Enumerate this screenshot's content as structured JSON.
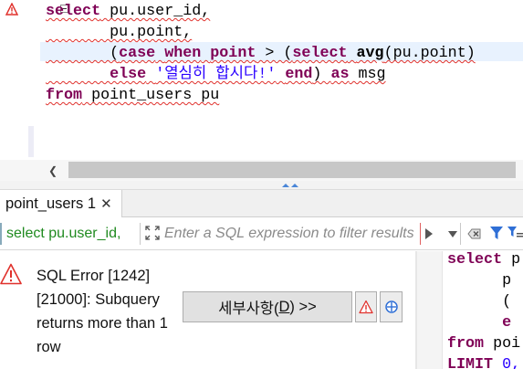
{
  "editor": {
    "lines": [
      [
        {
          "t": "select",
          "k": "kw"
        },
        {
          "t": " pu.user_id,",
          "k": "plain"
        }
      ],
      [
        {
          "t": "       pu.point,",
          "k": "plain"
        }
      ],
      [
        {
          "t": "       (",
          "k": "plain"
        },
        {
          "t": "case",
          "k": "kw"
        },
        {
          "t": " ",
          "k": "plain"
        },
        {
          "t": "when",
          "k": "kw"
        },
        {
          "t": " ",
          "k": "plain"
        },
        {
          "t": "point",
          "k": "kw"
        },
        {
          "t": " > (",
          "k": "plain"
        },
        {
          "t": "select",
          "k": "kw"
        },
        {
          "t": " ",
          "k": "plain"
        },
        {
          "t": "avg",
          "k": "fn"
        },
        {
          "t": "(pu.point)",
          "k": "plain"
        }
      ],
      [
        {
          "t": "       ",
          "k": "plain"
        },
        {
          "t": "else",
          "k": "kw"
        },
        {
          "t": " ",
          "k": "plain"
        },
        {
          "t": "'열심히 합시다!'",
          "k": "str"
        },
        {
          "t": " ",
          "k": "plain"
        },
        {
          "t": "end",
          "k": "kw"
        },
        {
          "t": ") ",
          "k": "plain"
        },
        {
          "t": "as",
          "k": "kw"
        },
        {
          "t": " msg",
          "k": "plain"
        }
      ],
      [
        {
          "t": "from",
          "k": "kw"
        },
        {
          "t": " point_users pu",
          "k": "plain"
        }
      ]
    ]
  },
  "results_tab": {
    "label": "point_users 1",
    "close": "✕"
  },
  "filter": {
    "query_label": "select pu.user_id,",
    "placeholder": "Enter a SQL expression to filter results"
  },
  "error": {
    "message": "SQL Error [1242] [21000]: Subquery returns more than 1 row",
    "details_button_prefix": "세부사항(",
    "details_button_mnemonic": "D",
    "details_button_suffix": ") >>"
  },
  "preview": {
    "lines": [
      [
        {
          "t": "select",
          "k": "kw"
        },
        {
          "t": " p",
          "k": "plain"
        }
      ],
      [
        {
          "t": "      p",
          "k": "plain"
        }
      ],
      [
        {
          "t": "      (",
          "k": "plain"
        }
      ],
      [
        {
          "t": "      ",
          "k": "plain"
        },
        {
          "t": "e",
          "k": "kw"
        }
      ],
      [
        {
          "t": "from",
          "k": "kw"
        },
        {
          "t": " poi",
          "k": "plain"
        }
      ],
      [
        {
          "t": "LIMIT",
          "k": "kw"
        },
        {
          "t": " 0,",
          "k": "str"
        }
      ]
    ]
  },
  "colors": {
    "keyword": "#7f0055",
    "string": "#2a00ff",
    "query_label": "#1f8a1f",
    "error_icon": "#e0312c",
    "accent_blue": "#2f6fd6"
  }
}
